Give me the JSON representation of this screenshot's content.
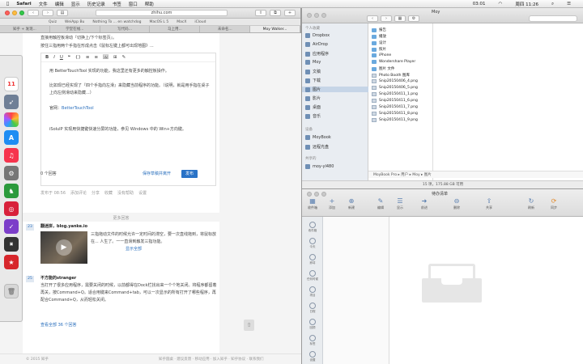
{
  "menubar": {
    "items": [
      "Safari",
      "文件",
      "编辑",
      "显示",
      "历史记录",
      "书签",
      "窗口",
      "帮助"
    ],
    "right": {
      "time": "周四 11:26",
      "battery": "03:01"
    }
  },
  "safari": {
    "url": "zhihu.com",
    "favorites": [
      "Quiz",
      "WeiApp Bu",
      "Nothing To ... en watchdog",
      "MacOS L 5",
      "MacX",
      "iCloud"
    ],
    "tabs": [
      "知乎 + 发现...",
      "学堂在线...",
      "写代码...",
      "马上用...",
      "未命名...",
      "Moy Walker..."
    ],
    "article": {
      "top_lines": [
        "直接用触控板滑动『切换上/下个标签页』。",
        "按住三指用两个手指在形成点击《鼠标左键上都可出现地图》..."
      ],
      "toolbar": [
        "B",
        "I",
        "U",
        "❝",
        "{}",
        "≡",
        "≡",
        "🖼",
        "⊞",
        "✎"
      ],
      "para1": "用 BetterTouchTool 实现的功能，我这里还有更多的触控板操作。",
      "para2": "比如现已经实现了『四个手指向左滑』来隐藏当前程序的功能。（说明，就是用手指在桌子上向左侧滑动来隐藏...）",
      "link_label": "官网：",
      "link": "BetterTouchTool",
      "bullet": "iSoluIP 实现用快捷键快速分屏的功能，参见 Windows 中的 Win+方向键。"
    },
    "editor_footer": {
      "count": "0 个回答",
      "save": "保存草稿并离开",
      "publish": "发布"
    },
    "meta": {
      "date": "发布于 08:56",
      "comments": "添加评论",
      "share": "分享",
      "collect": "收藏",
      "no_help": "没有帮助",
      "report": "设置"
    },
    "more_label": "更多回答",
    "feed": [
      {
        "num": "23",
        "title": "翻迷拼，blog.yanke.io",
        "body": "三指拖动文件的时候允许一定时间的滞空，要一次直线拖到，将鼠标放在... 人生了。一一直滑到触发三指功能。",
        "link": "显示全部"
      },
      {
        "num": "25",
        "title": "不方能的stranger",
        "body": "当打开了很多应用程序，需要关闭的时候，以前都得在Dock栏找出来一个个地关闭。将程序都留着再关，按Command+Q。适合用键来Command+tab，可以一次显示的所有打开了哪些程序，再配合Command+Q，从而轻松关闭。",
        "link": "查看全部 36 个回答"
      }
    ],
    "footer": {
      "copyright": "© 2015 知乎",
      "links": "知乎圆桌 · 建议反馈 · 移动应用 · 加入知乎 · 知乎协议 · 联系我们"
    }
  },
  "finder": {
    "title": "Moy",
    "sidebar_sections": [
      "个人收藏",
      "设备",
      "共享的"
    ],
    "sidebar": [
      "Dropbox",
      "AirDrop",
      "应用程序",
      "Moy",
      "文稿",
      "下载",
      "图片",
      "影片",
      "桌面",
      "音乐",
      "MoyBook",
      "远程光盘",
      "moy-yl480"
    ],
    "files": [
      "报告",
      "播放",
      "设计",
      "照片",
      "iPhone",
      "Wondershare Player",
      "图片 文件",
      "Photo Booth 图库",
      "Snip20150406_4.png",
      "Snip20150406_5.png",
      "Snip20150411_1.png",
      "Snip20150411_6.png",
      "Snip20150411_7.png",
      "Snip20150411_8.png",
      "Snip20150411_9.png"
    ],
    "path": "MoyBook Pro ▸ 用户 ▸ Moy ▸ 图片",
    "status": "15 项，175.88 GB 可用"
  },
  "todo": {
    "title": "待办清单",
    "toolbar": [
      "收件箱",
      "添加",
      "新建",
      "编辑",
      "显示",
      "前进",
      "删除",
      "共享",
      "刷新",
      "同步"
    ],
    "sidebar": [
      "收件箱",
      "今天",
      "即将",
      "任何时候",
      "项目",
      "日程",
      "回顾",
      "标签",
      "设置"
    ]
  },
  "dock_icons": [
    "calendar-icon",
    "launchpad-icon",
    "photos-icon",
    "appstore-icon",
    "music-icon",
    "settings-icon",
    "evernote-icon",
    "netease-music-icon",
    "omnifocus-icon",
    "screenflow-icon",
    "wunderlist-icon",
    "trash-icon"
  ]
}
